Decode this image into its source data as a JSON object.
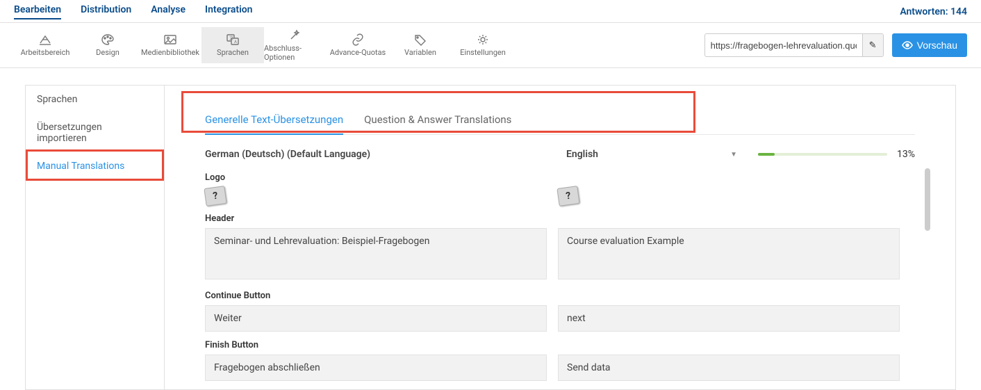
{
  "topnav": {
    "items": [
      "Bearbeiten",
      "Distribution",
      "Analyse",
      "Integration"
    ],
    "responses": "Antworten: 144"
  },
  "toolbar": {
    "items": [
      {
        "label": "Arbeitsbereich",
        "icon": "workspace"
      },
      {
        "label": "Design",
        "icon": "palette"
      },
      {
        "label": "Medienbibliothek",
        "icon": "image"
      },
      {
        "label": "Sprachen",
        "icon": "translate"
      },
      {
        "label": "Abschluss-Optionen",
        "icon": "wand"
      },
      {
        "label": "Advance-Quotas",
        "icon": "link"
      },
      {
        "label": "Variablen",
        "icon": "tag"
      },
      {
        "label": "Einstellungen",
        "icon": "gear"
      }
    ],
    "url": "https://fragebogen-lehrevaluation.quest",
    "preview": "Vorschau"
  },
  "sidebar": {
    "items": [
      "Sprachen",
      "Übersetzungen importieren",
      "Manual Translations"
    ]
  },
  "tabs": [
    "Generelle Text-Übersetzungen",
    "Question & Answer Translations"
  ],
  "lang": {
    "default": "German (Deutsch) (Default Language)",
    "target": "English",
    "progress_pct": "13%",
    "progress_fill": 13
  },
  "fields": {
    "logo": {
      "label": "Logo"
    },
    "header": {
      "label": "Header",
      "de": "Seminar- und Lehrevaluation: Beispiel-Fragebogen",
      "en": "Course evaluation Example"
    },
    "continue": {
      "label": "Continue Button",
      "de": "Weiter",
      "en": "next"
    },
    "finish": {
      "label": "Finish Button",
      "de": "Fragebogen abschließen",
      "en": "Send data"
    }
  }
}
